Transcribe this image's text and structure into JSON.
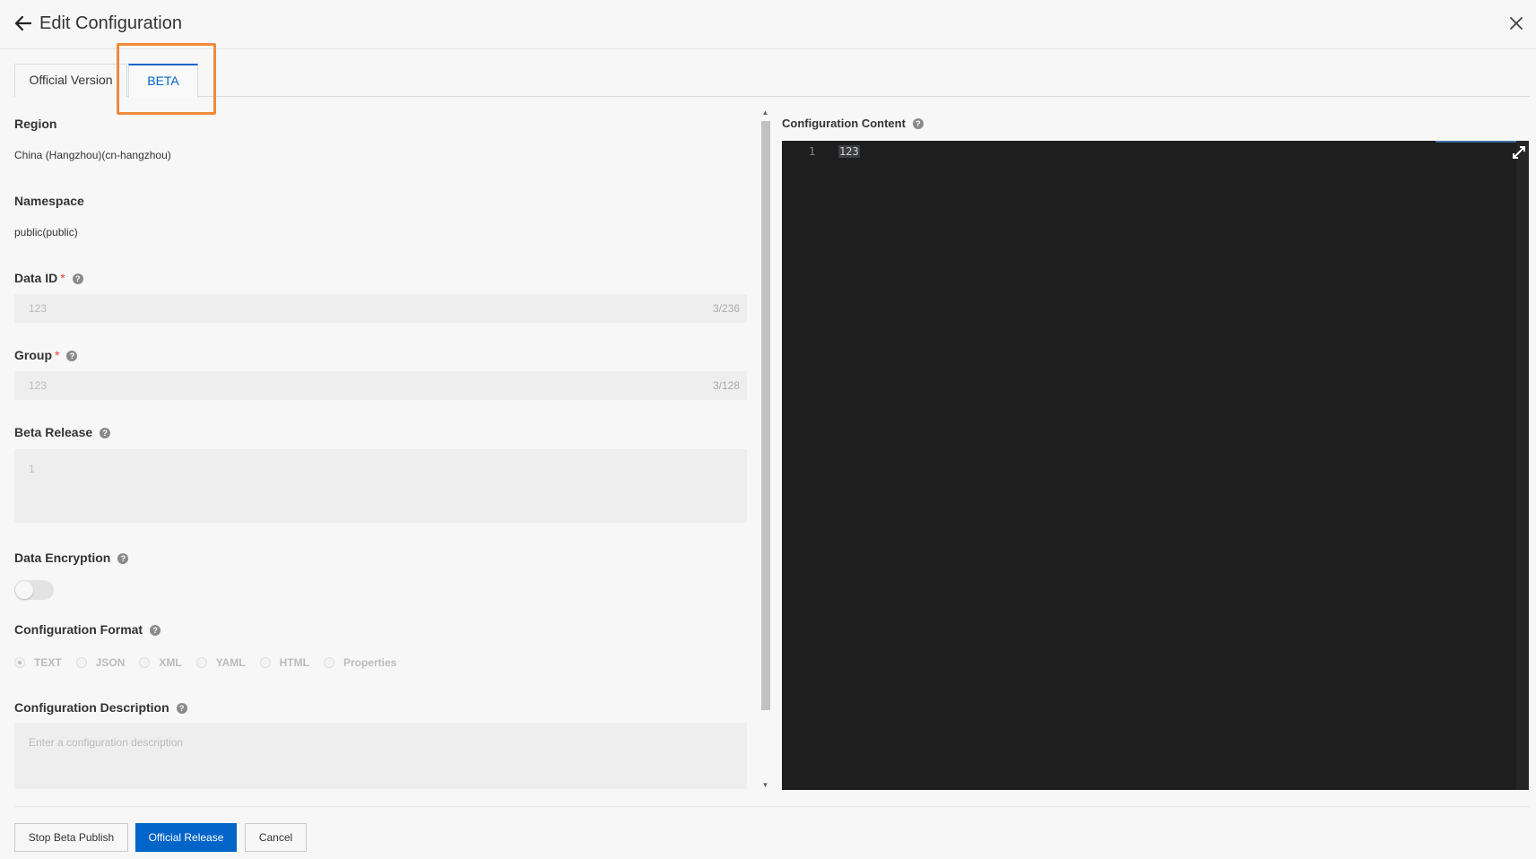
{
  "header": {
    "title": "Edit Configuration",
    "back_icon": "arrow-left-icon",
    "close_icon": "close-icon"
  },
  "tabs": [
    {
      "label": "Official Version",
      "active": false
    },
    {
      "label": "BETA",
      "active": true
    }
  ],
  "form": {
    "region": {
      "label": "Region",
      "value": "China (Hangzhou)(cn-hangzhou)"
    },
    "namespace": {
      "label": "Namespace",
      "value": "public(public)"
    },
    "data_id": {
      "label": "Data ID",
      "required_mark": "*",
      "value": "123",
      "counter": "3/236"
    },
    "group": {
      "label": "Group",
      "required_mark": "*",
      "value": "123",
      "counter": "3/128"
    },
    "beta_release": {
      "label": "Beta Release",
      "value": "1"
    },
    "data_encryption": {
      "label": "Data Encryption",
      "enabled": false
    },
    "config_format": {
      "label": "Configuration Format",
      "options": [
        "TEXT",
        "JSON",
        "XML",
        "YAML",
        "HTML",
        "Properties"
      ],
      "selected": "TEXT"
    },
    "config_description": {
      "label": "Configuration Description",
      "placeholder": "Enter a configuration description"
    }
  },
  "editor": {
    "label": "Configuration Content",
    "line_number": "1",
    "content": "123"
  },
  "footer": {
    "stop_beta_label": "Stop Beta Publish",
    "official_release_label": "Official Release",
    "cancel_label": "Cancel"
  },
  "colors": {
    "primary": "#0064c8",
    "highlight": "#f08a3a",
    "editor_bg": "#1e1e1e",
    "required": "#e8453c"
  }
}
